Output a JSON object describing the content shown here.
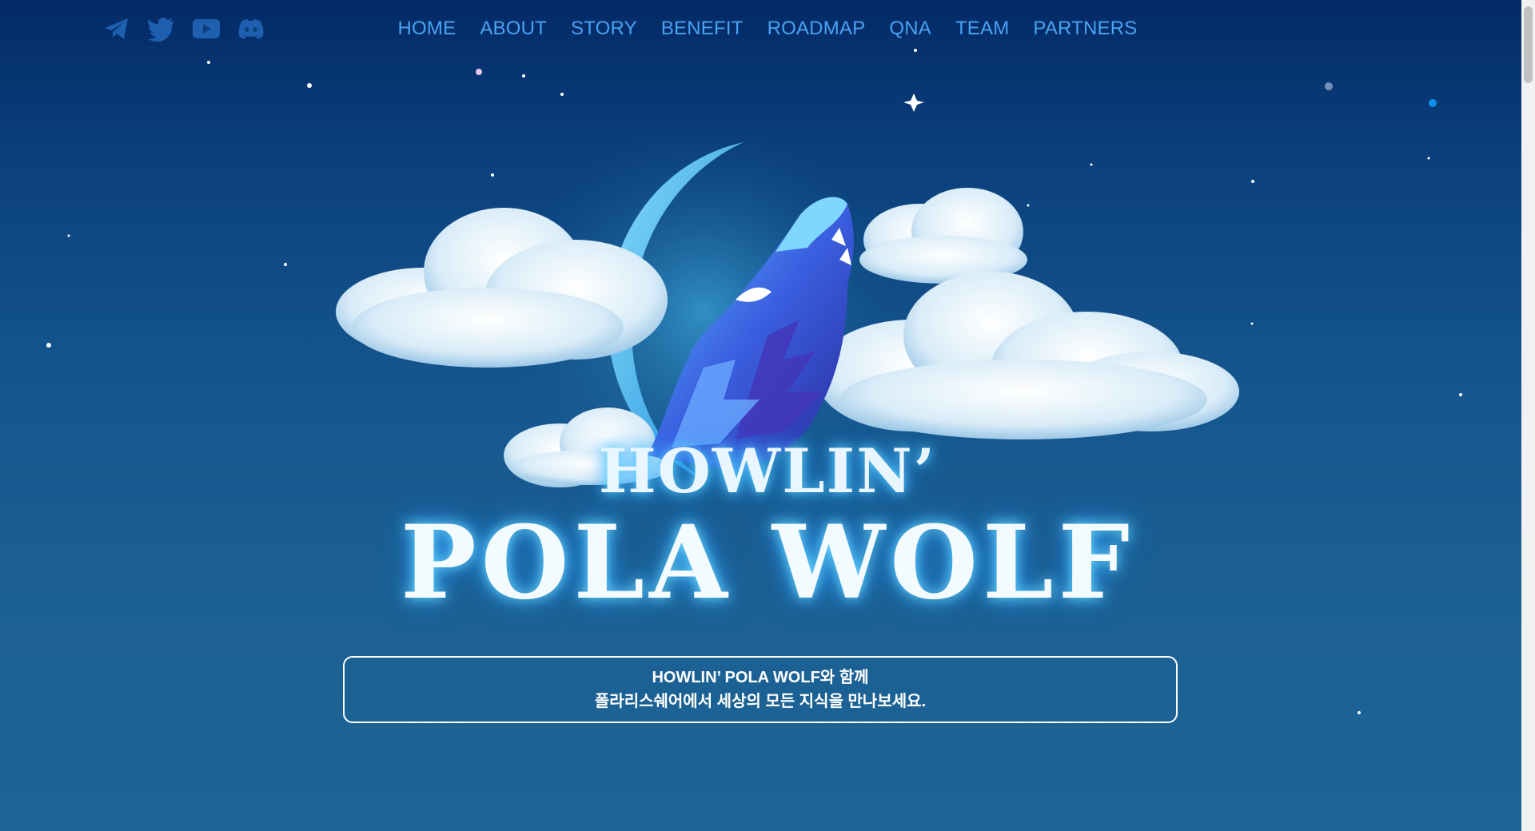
{
  "nav": {
    "items": [
      "HOME",
      "ABOUT",
      "STORY",
      "BENEFIT",
      "ROADMAP",
      "QNA",
      "TEAM",
      "PARTNERS"
    ]
  },
  "social": {
    "icons": [
      "telegram-icon",
      "twitter-icon",
      "youtube-icon",
      "discord-icon"
    ],
    "color": "#1f5fb0"
  },
  "hero": {
    "title_line1": "HOWLIN’",
    "title_line2": "POLA WOLF"
  },
  "info_box": {
    "line1": "HOWLIN’ POLA WOLF와 함께",
    "line2": "폴라리스쉐어에서 세상의 모든 지식을 만나보세요."
  },
  "colors": {
    "nav_link": "#4aa2f2",
    "background_top": "#032a66",
    "background_bottom": "#1e6496",
    "glow": "#2596ff"
  }
}
